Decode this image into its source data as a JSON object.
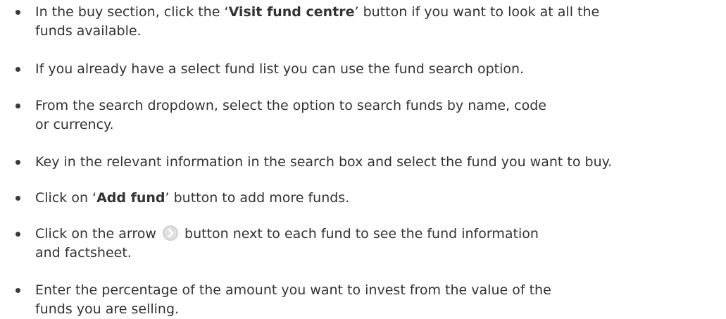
{
  "instructions": {
    "item1": {
      "pre": "In the buy section, click the ‘",
      "bold": "Visit fund centre",
      "post": "’ button if you want to look at all the",
      "line2": "funds available."
    },
    "item2": {
      "line1": "If you already have a select fund list you can use the fund search option."
    },
    "item3": {
      "line1": "From the search dropdown, select the option to search funds by name, code",
      "line2": "or currency."
    },
    "item4": {
      "line1": "Key in the relevant information in the search box and select the fund you want to buy."
    },
    "item5": {
      "pre": "Click on ‘",
      "bold": "Add fund",
      "post": "’ button to add more funds."
    },
    "item6": {
      "pre": "Click on the arrow",
      "post": "button next to each fund to see the fund information",
      "line2": "and factsheet.",
      "icon": "arrow-circle-icon"
    },
    "item7": {
      "line1": "Enter the percentage of the amount you want to invest from the value of the",
      "line2": "funds you are selling."
    }
  },
  "colors": {
    "text": "#333333",
    "bullet": "#3a3a3a",
    "icon_circle": "#cccccc",
    "icon_arrow": "#ffffff"
  }
}
